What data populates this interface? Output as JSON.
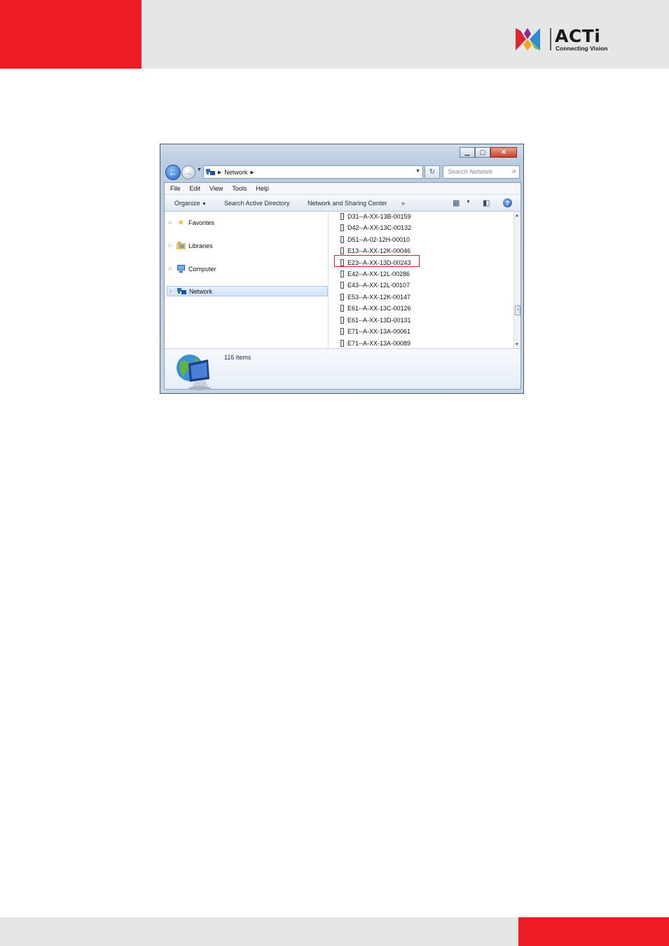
{
  "brand": {
    "logo_word": "ACTi",
    "tagline": "Connecting Vision",
    "accent_red": "#ed1c24",
    "band_gray": "#e6e6e6"
  },
  "window": {
    "address": {
      "location": "Network"
    },
    "search": {
      "placeholder": "Search Network"
    },
    "caption_buttons": [
      "minimize",
      "maximize",
      "close"
    ],
    "menu": [
      "File",
      "Edit",
      "View",
      "Tools",
      "Help"
    ],
    "commands": {
      "organize": "Organize",
      "search_ad": "Search Active Directory",
      "network_center": "Network and Sharing Center",
      "more": "»"
    },
    "nav_pane": [
      {
        "label": "Favorites",
        "icon": "star-icon"
      },
      {
        "label": "Libraries",
        "icon": "library-icon"
      },
      {
        "label": "Computer",
        "icon": "computer-icon"
      },
      {
        "label": "Network",
        "icon": "network-icon",
        "selected": true
      }
    ],
    "devices": [
      "D31--A-XX-13B-00159",
      "D42--A-XX-13C-00132",
      "D51--A-02-12H-00010",
      "E13--A-XX-12K-00046",
      "E23--A-XX-13D-00243",
      "E42--A-XX-12L-00286",
      "E43--A-XX-12L-00107",
      "E53--A-XX-12K-00147",
      "E61--A-XX-13C-00126",
      "E61--A-XX-13D-00131",
      "E71--A-XX-13A-00061",
      "E71--A-XX-13A-00089"
    ],
    "highlighted_device": "E23--A-XX-13D-00243",
    "details": {
      "item_count": "116 items"
    }
  }
}
